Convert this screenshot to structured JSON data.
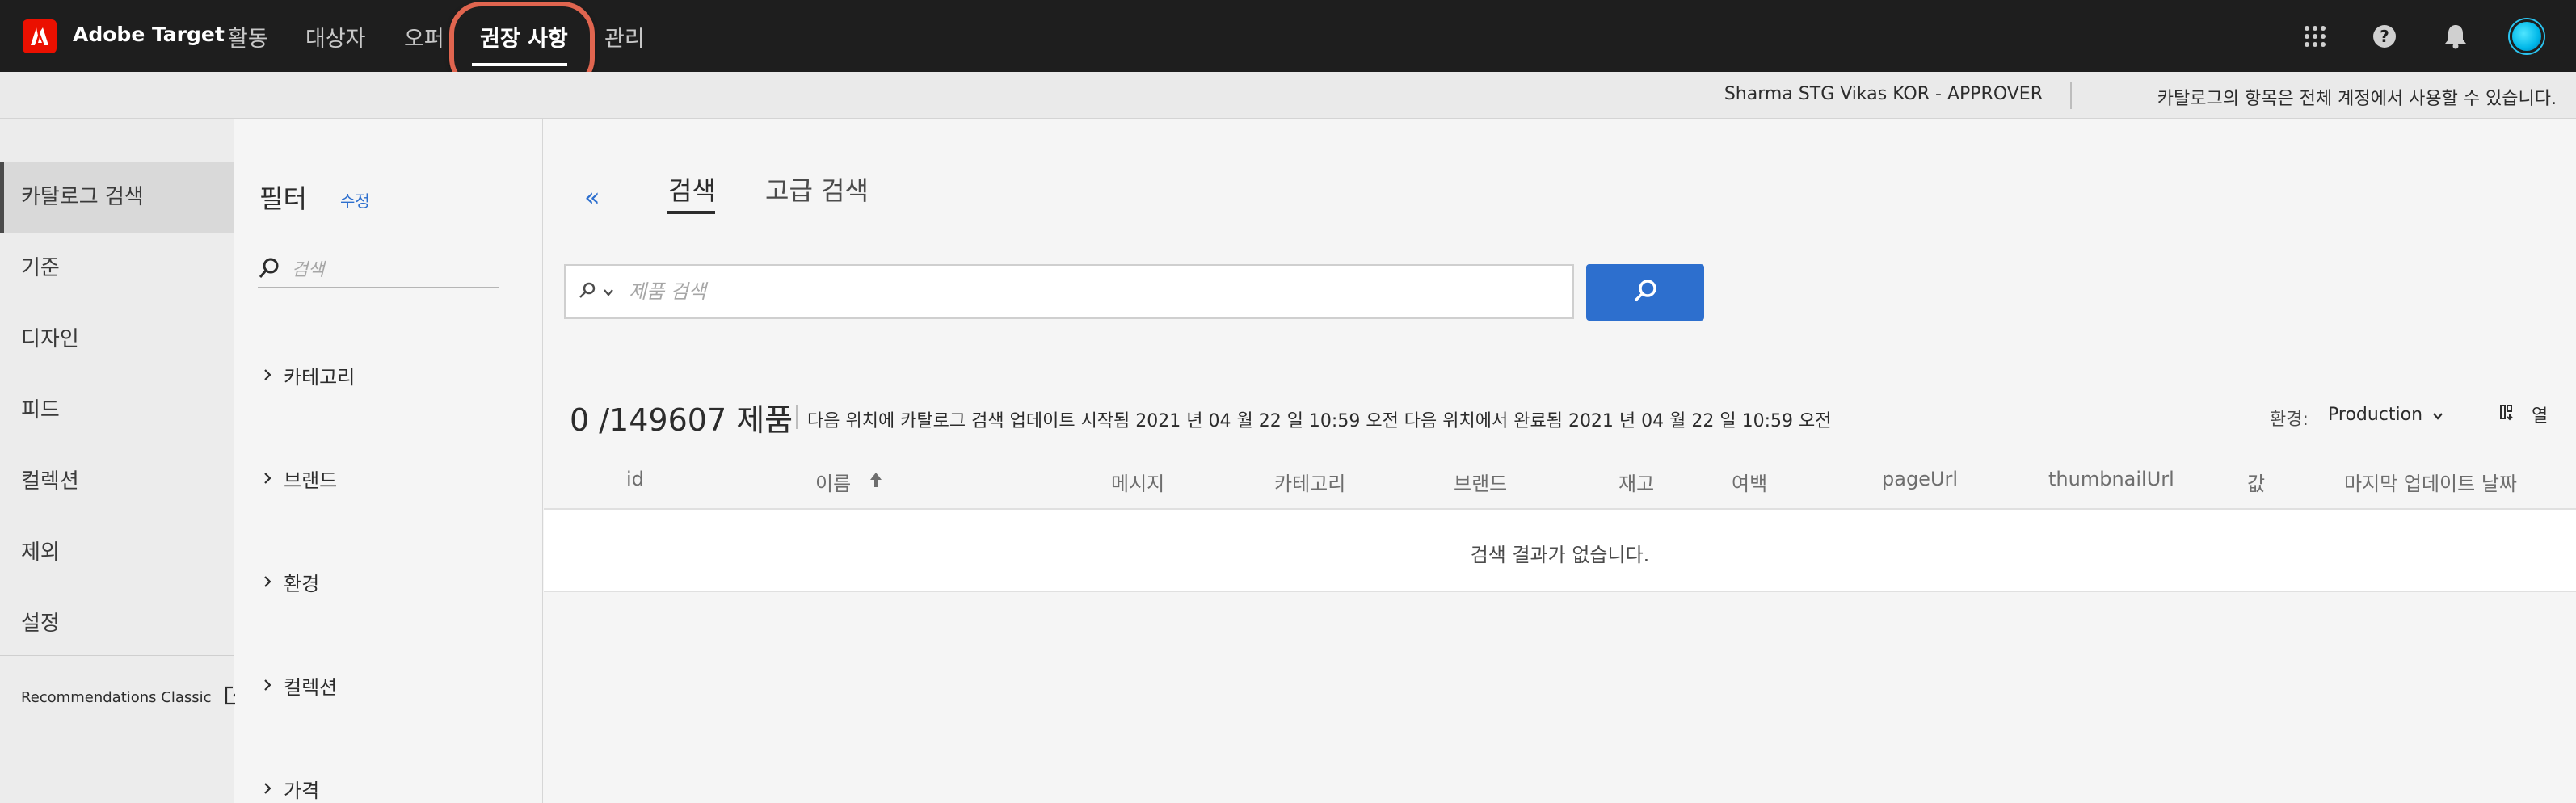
{
  "app": {
    "name": "Adobe Target"
  },
  "nav": [
    {
      "label": "활동"
    },
    {
      "label": "대상자"
    },
    {
      "label": "오퍼"
    },
    {
      "label": "권장 사항"
    },
    {
      "label": "관리"
    }
  ],
  "subbar": {
    "user": "Sharma STG Vikas KOR - APPROVER",
    "note": "카탈로그의 항목은 전체 계정에서 사용할 수 있습니다."
  },
  "leftnav": {
    "items": [
      {
        "label": "카탈로그 검색"
      },
      {
        "label": "기준"
      },
      {
        "label": "디자인"
      },
      {
        "label": "피드"
      },
      {
        "label": "컬렉션"
      },
      {
        "label": "제외"
      },
      {
        "label": "설정"
      }
    ],
    "classic": "Recommendations Classic"
  },
  "filters": {
    "title": "필터",
    "edit": "수정",
    "search_placeholder": "검색",
    "facets": [
      {
        "label": "카테고리"
      },
      {
        "label": "브랜드"
      },
      {
        "label": "환경"
      },
      {
        "label": "컬렉션"
      },
      {
        "label": "가격"
      }
    ]
  },
  "main": {
    "collapse": "«",
    "tabs": [
      {
        "label": "검색"
      },
      {
        "label": "고급 검색"
      }
    ],
    "search_placeholder": "제품 검색",
    "count": "0 /149607 제품",
    "updated": "다음 위치에 카탈로그 검색 업데이트 시작됨 2021 년 04 월 22 일 10:59 오전 다음 위치에서 완료됨 2021 년 04 월 22 일 10:59 오전",
    "env_label": "환경:",
    "env_value": "Production",
    "columns_label": "열",
    "columns": [
      {
        "label": "id"
      },
      {
        "label": "이름"
      },
      {
        "label": "메시지"
      },
      {
        "label": "카테고리"
      },
      {
        "label": "브랜드"
      },
      {
        "label": "재고"
      },
      {
        "label": "여백"
      },
      {
        "label": "pageUrl"
      },
      {
        "label": "thumbnailUrl"
      },
      {
        "label": "값"
      },
      {
        "label": "마지막 업데이트 날짜"
      }
    ],
    "empty": "검색 결과가 없습니다."
  },
  "colors": {
    "accent": "#2d6fce",
    "topbar": "#1e1e1e",
    "highlight": "#e0654f",
    "brand": "#eb1000"
  },
  "icons": [
    "adobe-logo-icon",
    "apps-grid-icon",
    "help-icon",
    "bell-icon",
    "search-icon",
    "chevron-down-icon",
    "chevron-right-icon",
    "sort-up-icon",
    "external-link-icon",
    "columns-icon"
  ]
}
